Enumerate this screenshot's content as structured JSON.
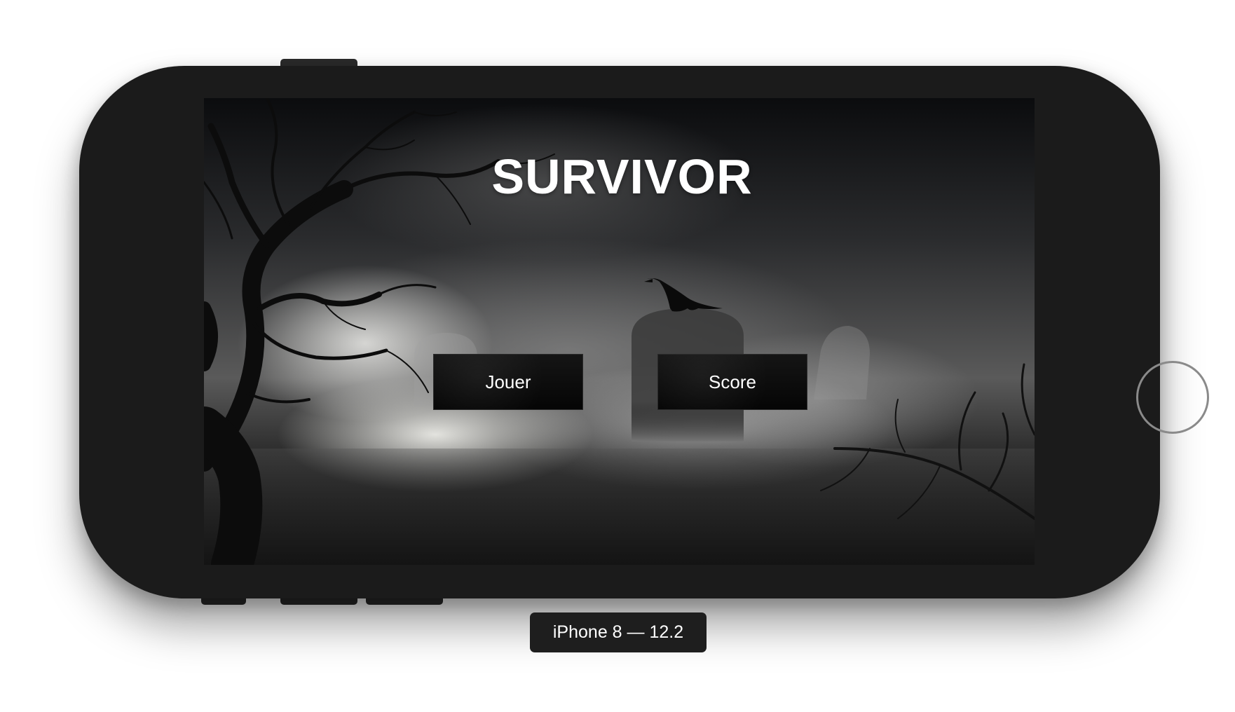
{
  "game": {
    "title": "SURVIVOR",
    "buttons": {
      "play_label": "Jouer",
      "score_label": "Score"
    }
  },
  "simulator": {
    "device_label": "iPhone 8 — 12.2"
  },
  "colors": {
    "device_body": "#1b1b1b",
    "button_bg": "#0b0b0b",
    "title_text": "#ffffff",
    "label_bg": "#1e1e1e"
  }
}
